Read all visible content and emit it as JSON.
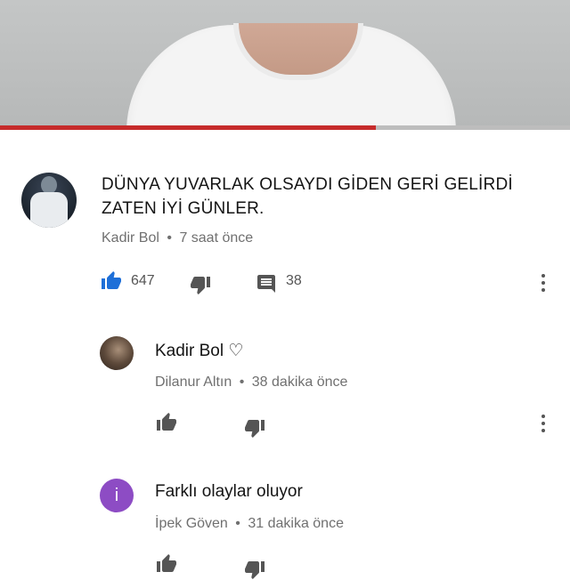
{
  "player": {
    "progress_percent": 66
  },
  "colors": {
    "progress": "#c62b2b",
    "like_active": "#1e6fd8",
    "reply_avatar_purple": "#8d4cc4"
  },
  "comment": {
    "text_line1": "DÜNYA YUVARLAK OLSAYDI GİDEN GERİ GELİRDİ",
    "text_line2": "ZATEN İYİ GÜNLER.",
    "author": "Kadir Bol",
    "separator": "•",
    "time": "7 saat önce",
    "likes": "647",
    "replies": "38"
  },
  "replies": [
    {
      "text": "Kadir Bol ♡",
      "author": "Dilanur Altın",
      "time": "38 dakika önce",
      "avatar_letter": ""
    },
    {
      "text": "Farklı olaylar oluyor",
      "author": "İpek Göven",
      "time": "31 dakika önce",
      "avatar_letter": "i"
    }
  ],
  "icons": [
    "thumbs-up-icon",
    "thumbs-down-icon",
    "comment-icon",
    "more-vert-icon"
  ]
}
